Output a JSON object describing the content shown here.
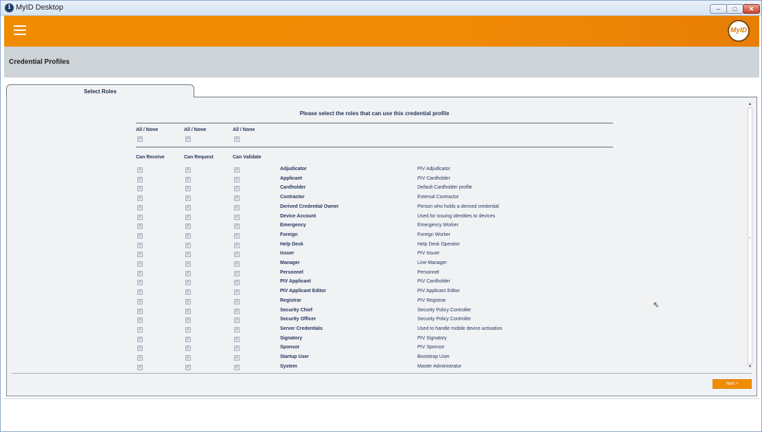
{
  "window": {
    "title": "MyID Desktop",
    "icon": "info-icon",
    "min": "–",
    "max": "□",
    "close": "✕"
  },
  "header": {
    "logo_text": "MyID",
    "brand_color": "#f08c00"
  },
  "page": {
    "title": "Credential Profiles"
  },
  "tabs": [
    {
      "label": "Select Roles",
      "active": true
    }
  ],
  "main": {
    "instruction": "Please select the roles that can use this credential profile",
    "all_none": [
      "All / None",
      "All / None",
      "All / None"
    ],
    "columns": [
      "Can Receive",
      "Can Request",
      "Can Validate"
    ],
    "roles": [
      {
        "name": "Adjudicator",
        "description": "PIV Adjudicator"
      },
      {
        "name": "Applicant",
        "description": "PIV Cardholder"
      },
      {
        "name": "Cardholder",
        "description": "Default Cardholder profile"
      },
      {
        "name": "Contractor",
        "description": "External Contractor"
      },
      {
        "name": "Derived Credential Owner",
        "description": "Person who holds a derived credential"
      },
      {
        "name": "Device Account",
        "description": "Used for issuing identities to devices"
      },
      {
        "name": "Emergency",
        "description": "Emergency Worker"
      },
      {
        "name": "Foreign",
        "description": "Foreign Worker"
      },
      {
        "name": "Help Desk",
        "description": "Help Desk Operator"
      },
      {
        "name": "Issuer",
        "description": "PIV Issuer"
      },
      {
        "name": "Manager",
        "description": "Line Manager"
      },
      {
        "name": "Personnel",
        "description": "Personnel"
      },
      {
        "name": "PIV Applicant",
        "description": "PIV Cardholder"
      },
      {
        "name": "PIV Applicant Editor",
        "description": "PIV Applicant Editor"
      },
      {
        "name": "Registrar",
        "description": "PIV Registrar"
      },
      {
        "name": "Security Chief",
        "description": "Security Policy Controller"
      },
      {
        "name": "Security Officer",
        "description": "Security Policy Controller"
      },
      {
        "name": "Server Credentials",
        "description": "Used to handle mobile device activation"
      },
      {
        "name": "Signatory",
        "description": "PIV Signatory"
      },
      {
        "name": "Sponsor",
        "description": "PIV Sponsor"
      },
      {
        "name": "Startup User",
        "description": "Bootstrap User"
      },
      {
        "name": "System",
        "description": "Master Administrator"
      }
    ],
    "checked": true
  },
  "footer": {
    "next_label": "Next >"
  },
  "scrollbar": {
    "up": "▲",
    "down": "▼",
    "grip": "≡"
  },
  "checkmark": "✓"
}
